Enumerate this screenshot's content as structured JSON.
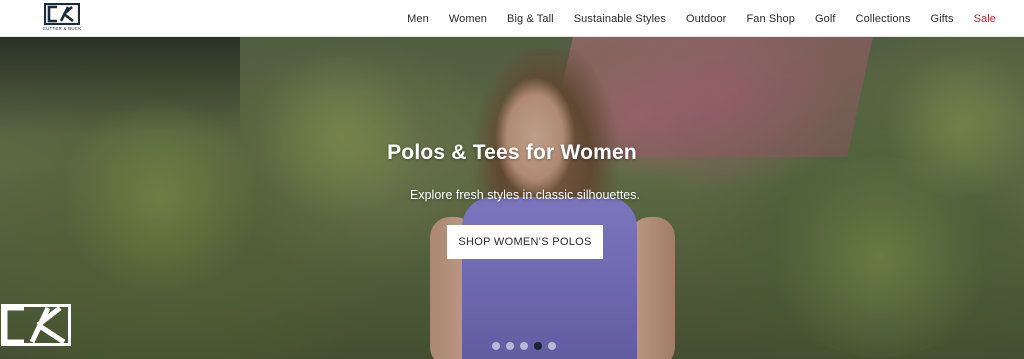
{
  "brand": {
    "logo_text": "CUTTER & BUCK"
  },
  "nav": {
    "items": [
      {
        "label": "Men",
        "name": "nav-men"
      },
      {
        "label": "Women",
        "name": "nav-women"
      },
      {
        "label": "Big & Tall",
        "name": "nav-big-tall"
      },
      {
        "label": "Sustainable Styles",
        "name": "nav-sustainable-styles"
      },
      {
        "label": "Outdoor",
        "name": "nav-outdoor"
      },
      {
        "label": "Fan Shop",
        "name": "nav-fan-shop"
      },
      {
        "label": "Golf",
        "name": "nav-golf"
      },
      {
        "label": "Collections",
        "name": "nav-collections"
      },
      {
        "label": "Gifts",
        "name": "nav-gifts"
      },
      {
        "label": "Sale",
        "name": "nav-sale"
      }
    ],
    "sale_color": "#c2282d"
  },
  "hero": {
    "title": "Polos & Tees for Women",
    "subtitle": "Explore fresh styles in classic silhouettes.",
    "cta_label": "SHOP WOMEN'S POLOS",
    "carousel": {
      "slide_count": 5,
      "active_index": 3
    }
  },
  "colors": {
    "active_dot": "#1d2233",
    "brand_navy": "#1c2b3a"
  }
}
